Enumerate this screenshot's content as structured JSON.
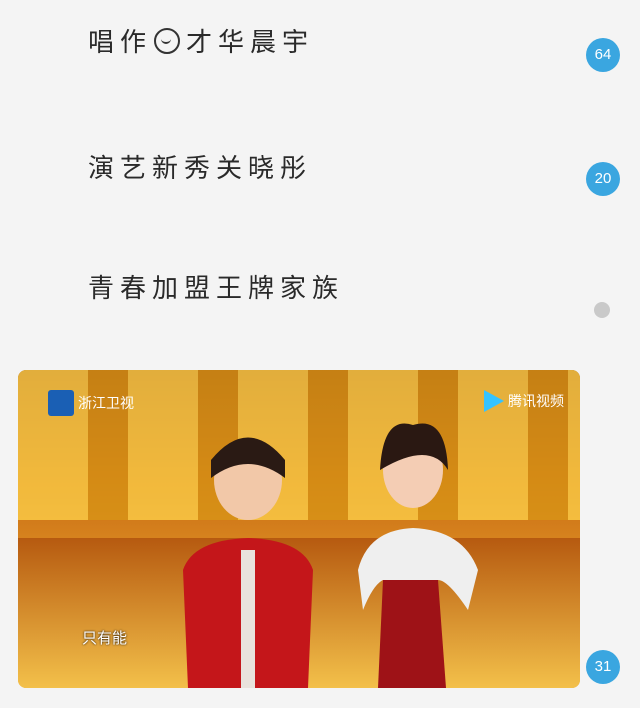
{
  "feed": {
    "items": [
      {
        "caption_before": "唱作",
        "caption_after": "才华晨宇",
        "count": "64"
      },
      {
        "caption": "演艺新秀关晓彤",
        "count": "20"
      },
      {
        "caption": "青春加盟王牌家族"
      }
    ],
    "media": {
      "channel_logo_text": "浙江卫视",
      "platform_logo_text": "腾讯视频",
      "subtitle": "只有能",
      "count": "31"
    }
  },
  "colors": {
    "badge": "#3aa6e0",
    "dot": "#c9c9c9"
  }
}
